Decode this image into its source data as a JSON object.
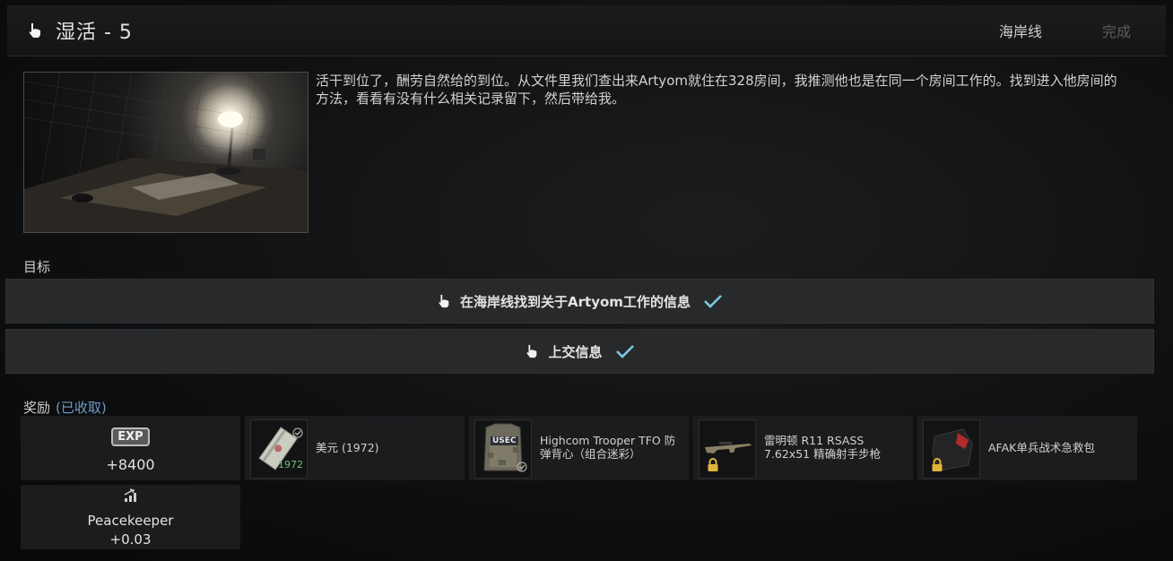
{
  "header": {
    "title": "湿活 - 5",
    "location": "海岸线",
    "status": "完成"
  },
  "description": "活干到位了，酬劳自然给的到位。从文件里我们查出来Artyom就住在328房间，我推测他也是在同一个房间工作的。找到进入他房间的方法，看看有没有什么相关记录留下，然后带给我。",
  "objectives_label": "目标",
  "objectives": [
    {
      "text": "在海岸线找到关于Artyom工作的信息",
      "completed": true
    },
    {
      "text": "上交信息",
      "completed": true
    }
  ],
  "rewards_label": "奖励",
  "rewards_status": "(已收取)",
  "rewards": {
    "exp": {
      "badge": "EXP",
      "value": "+8400"
    },
    "reputation": {
      "trader": "Peacekeeper",
      "value": "+0.03"
    },
    "items": [
      {
        "name": "美元 (1972)",
        "icon_text": "1972",
        "icon": "dollar-stack-icon",
        "locked": false
      },
      {
        "name": "Highcom Trooper TFO 防弹背心（组合迷彩）",
        "icon_text": "USEC",
        "icon": "armor-vest-icon",
        "locked": false
      },
      {
        "name": "雷明顿 R11 RSASS 7.62x51 精确射手步枪",
        "icon": "rifle-icon",
        "locked": true
      },
      {
        "name": "AFAK单兵战术急救包",
        "icon": "medkit-icon",
        "locked": true
      }
    ]
  },
  "colors": {
    "accent_check": "#7ec8e3",
    "claimed_text": "#6d9bc8",
    "lock_gold": "#e0b43a"
  }
}
